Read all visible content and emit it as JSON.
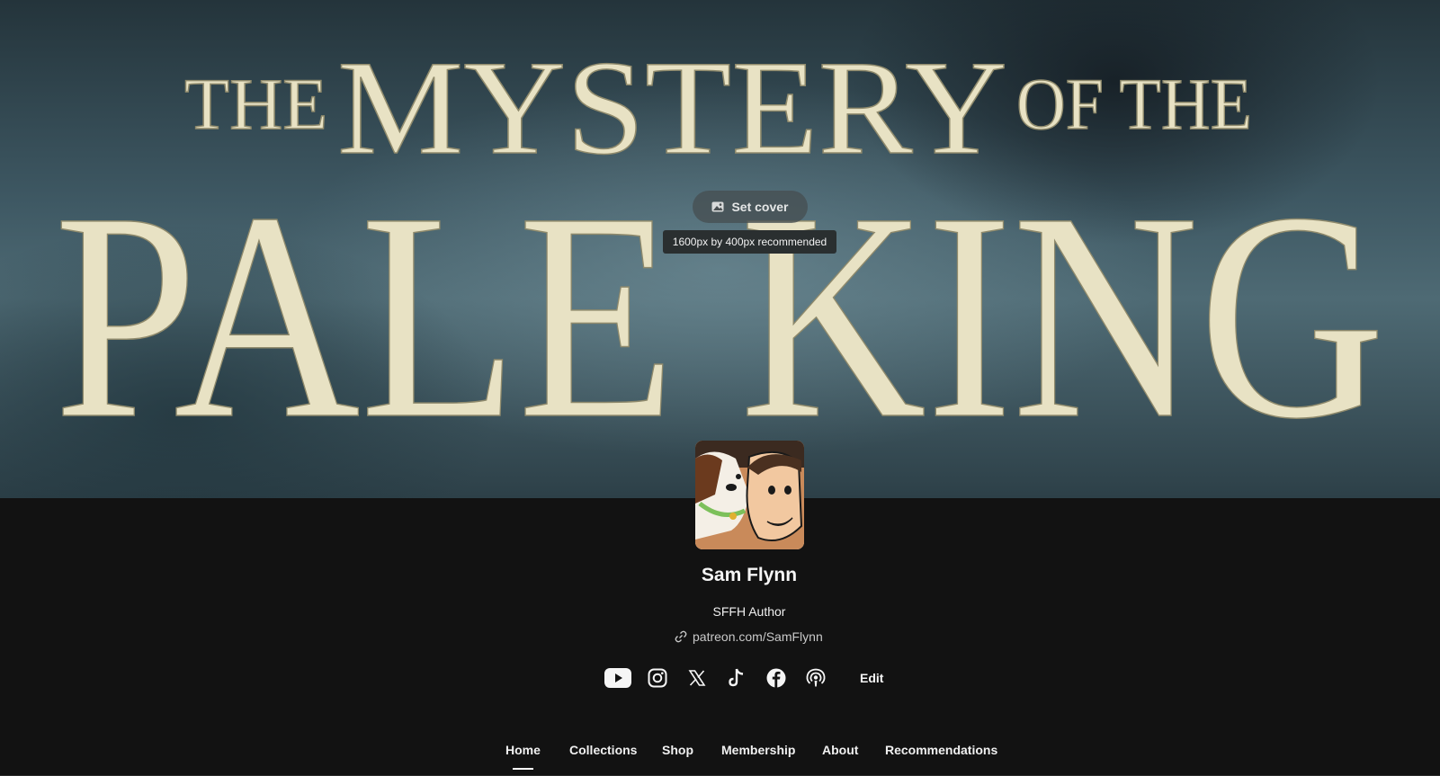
{
  "cover": {
    "title_line1_a": "THE",
    "title_line1_b": "MYSTERY",
    "title_line1_c": "OF THE",
    "title_line2": "PALE KING",
    "set_cover_label": "Set cover",
    "tooltip": "1600px by 400px recommended"
  },
  "profile": {
    "name": "Sam Flynn",
    "tagline": "SFFH Author",
    "link": "patreon.com/SamFlynn"
  },
  "social": {
    "icons": [
      "youtube-icon",
      "instagram-icon",
      "x-icon",
      "tiktok-icon",
      "facebook-icon",
      "podcast-icon"
    ],
    "edit_label": "Edit"
  },
  "tabs": [
    {
      "label": "Home",
      "active": true
    },
    {
      "label": "Collections",
      "active": false
    },
    {
      "label": "Shop",
      "active": false
    },
    {
      "label": "Membership",
      "active": false
    },
    {
      "label": "About",
      "active": false
    },
    {
      "label": "Recommendations",
      "active": false
    }
  ],
  "colors": {
    "background": "#121212",
    "cover_text": "#e8e2c4",
    "tab_text": "#f0f0f0"
  }
}
